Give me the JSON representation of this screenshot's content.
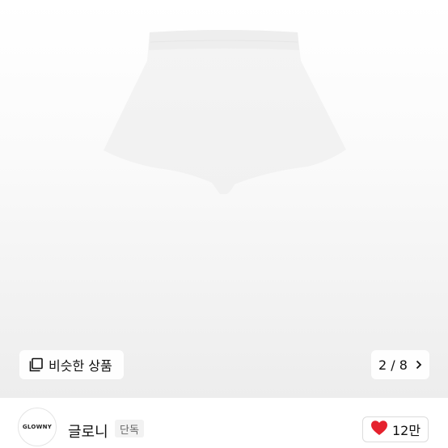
{
  "product": {
    "image_description": "white shorts"
  },
  "similar": {
    "label": "비슷한 상품",
    "icon": "similar-items-icon"
  },
  "pager": {
    "text": "2 / 8",
    "icon": "chevron-right-icon"
  },
  "brand": {
    "logo_text": "GLOWNY",
    "name": "글로니",
    "badge": "단독"
  },
  "like": {
    "icon": "heart-icon",
    "count": "12만",
    "heart_color": "#e5212d"
  }
}
